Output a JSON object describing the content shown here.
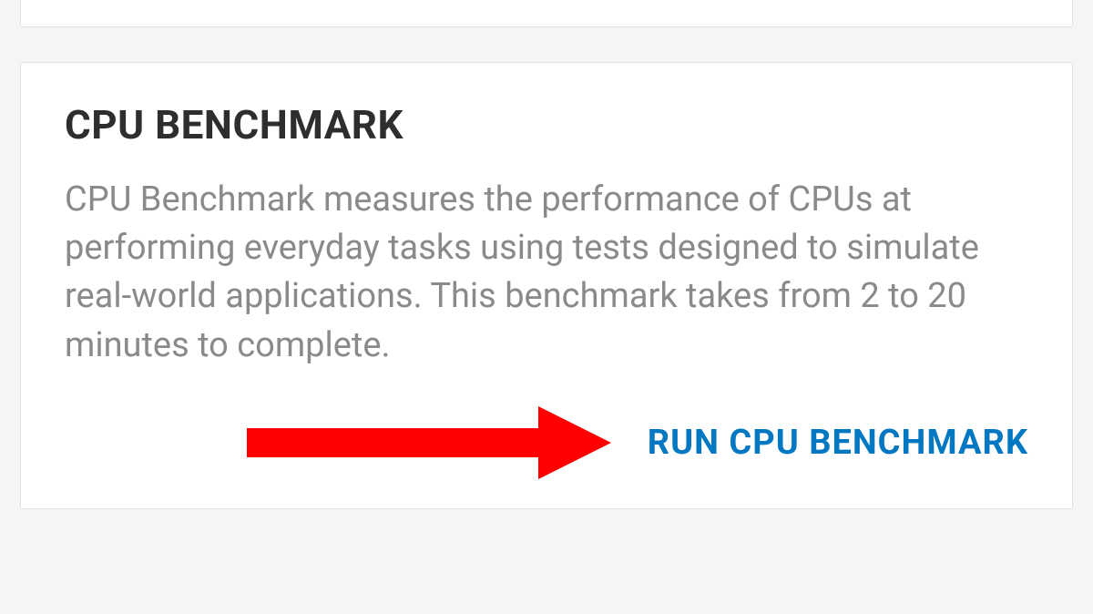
{
  "card": {
    "title": "CPU BENCHMARK",
    "description": "CPU Benchmark measures the performance of CPUs at performing everyday tasks using tests designed to simulate real-world applications. This benchmark takes from 2 to 20 minutes to complete.",
    "action_label": "RUN CPU BENCHMARK"
  },
  "annotation": {
    "arrow_color": "#ff0000"
  }
}
